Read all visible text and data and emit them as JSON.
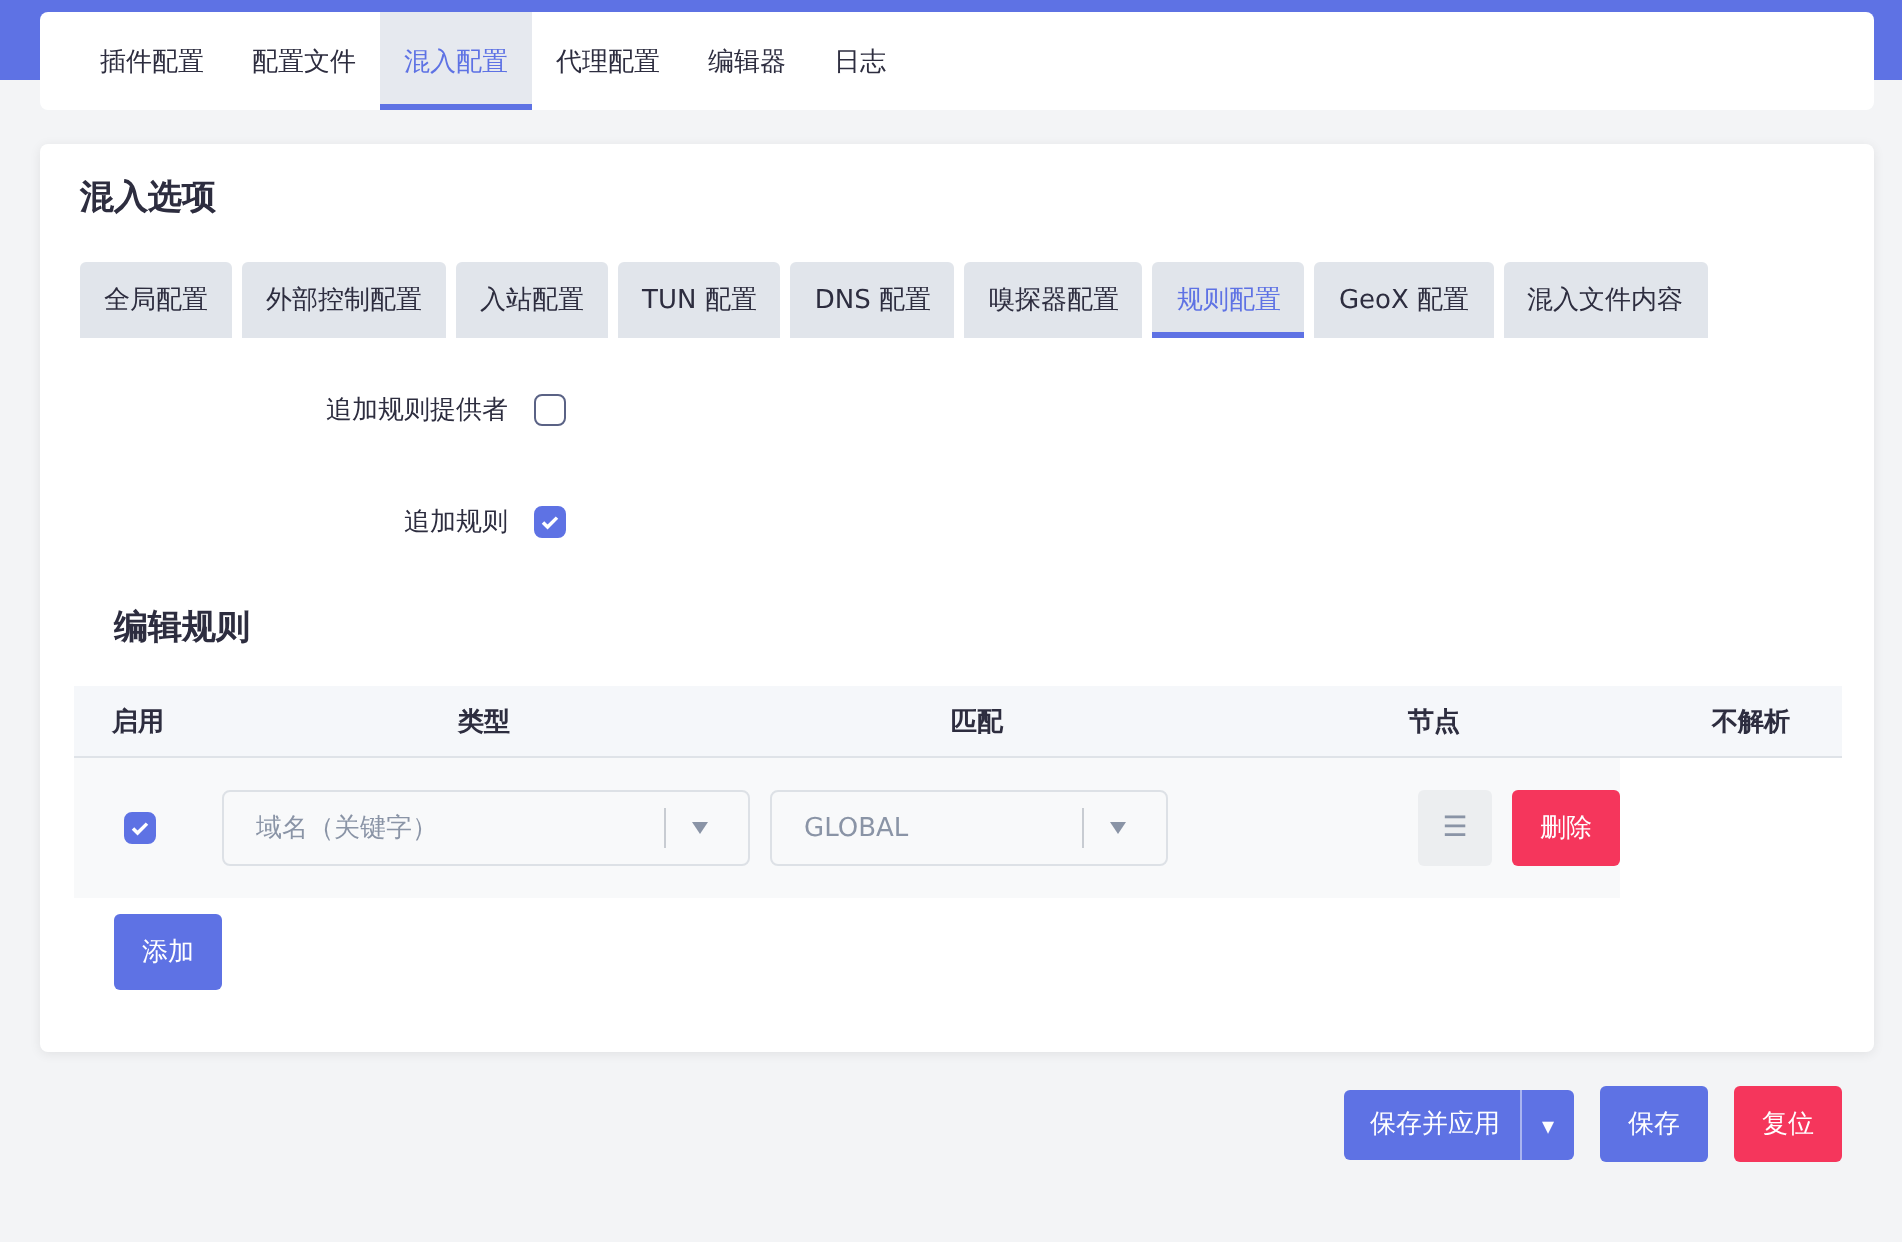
{
  "top_tabs": [
    {
      "label": "插件配置",
      "selected": false
    },
    {
      "label": "配置文件",
      "selected": false
    },
    {
      "label": "混入配置",
      "selected": true
    },
    {
      "label": "代理配置",
      "selected": false
    },
    {
      "label": "编辑器",
      "selected": false
    },
    {
      "label": "日志",
      "selected": false
    }
  ],
  "section_title": "混入选项",
  "sub_tabs": [
    {
      "label": "全局配置",
      "selected": false
    },
    {
      "label": "外部控制配置",
      "selected": false
    },
    {
      "label": "入站配置",
      "selected": false
    },
    {
      "label": "TUN 配置",
      "selected": false
    },
    {
      "label": "DNS 配置",
      "selected": false
    },
    {
      "label": "嗅探器配置",
      "selected": false
    },
    {
      "label": "规则配置",
      "selected": true
    },
    {
      "label": "GeoX 配置",
      "selected": false
    },
    {
      "label": "混入文件内容",
      "selected": false
    }
  ],
  "options": [
    {
      "label": "追加规则提供者",
      "checked": false
    },
    {
      "label": "追加规则",
      "checked": true
    }
  ],
  "rules_title": "编辑规则",
  "table": {
    "columns": [
      "启用",
      "类型",
      "匹配",
      "节点",
      "不解析"
    ],
    "rows": [
      {
        "enabled": true,
        "type": {
          "placeholder": "域名（关键字）"
        },
        "match": {
          "value": "GLOBAL"
        },
        "node_button": "☰",
        "delete_button": "删除"
      }
    ]
  },
  "add_button": "添加",
  "footer": {
    "save_apply": "保存并应用",
    "caret": "▾",
    "save": "保存",
    "reset": "复位"
  }
}
